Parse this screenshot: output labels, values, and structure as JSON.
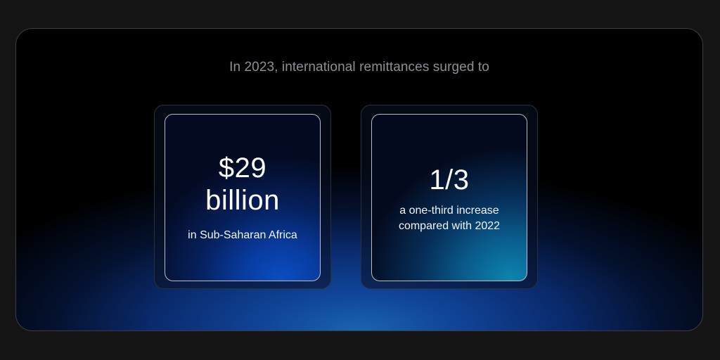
{
  "headline": "In 2023, international remittances surged to",
  "cards": [
    {
      "stat_line1": "$29",
      "stat_line2": "billion",
      "caption": "in Sub-Saharan Africa"
    },
    {
      "stat_line1": "1/3",
      "caption": "a one-third increase compared with 2022"
    }
  ],
  "colors": {
    "page_background": "#141414",
    "headline_text": "#8b8f96",
    "card_accent_blue": "#0a4fc4",
    "card_accent_teal": "#0c86b0"
  }
}
